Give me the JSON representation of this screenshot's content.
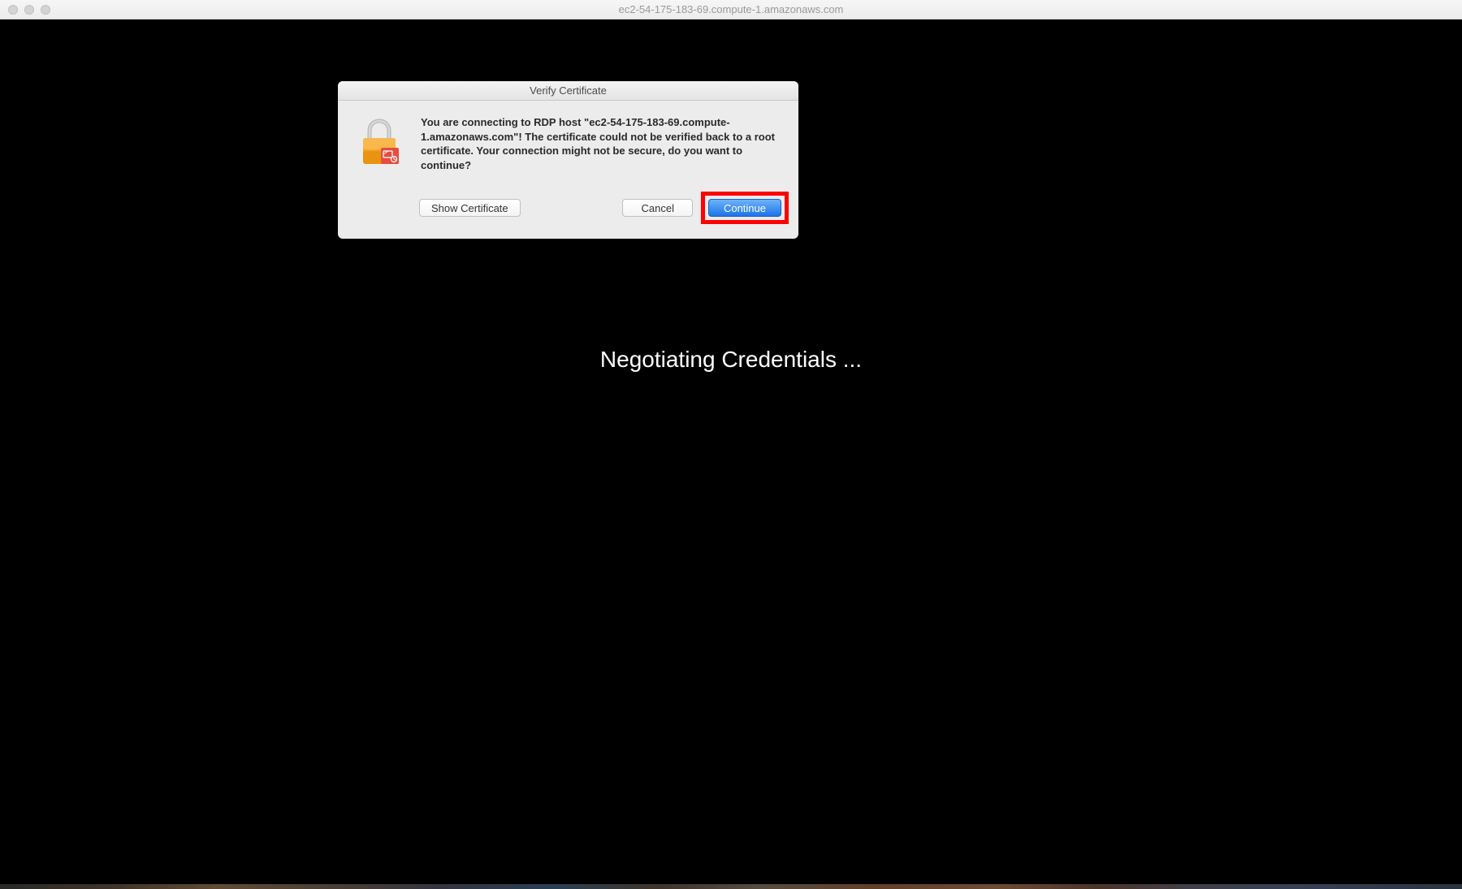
{
  "window": {
    "title": "ec2-54-175-183-69.compute-1.amazonaws.com"
  },
  "remote": {
    "status_text": "Negotiating Credentials ..."
  },
  "dialog": {
    "title": "Verify Certificate",
    "message": "You are connecting to RDP host \"ec2-54-175-183-69.compute-1.amazonaws.com\"! The certificate could not be verified back to a root certificate. Your connection might not be secure, do you want to continue?",
    "buttons": {
      "show_certificate": "Show Certificate",
      "cancel": "Cancel",
      "continue": "Continue"
    }
  }
}
